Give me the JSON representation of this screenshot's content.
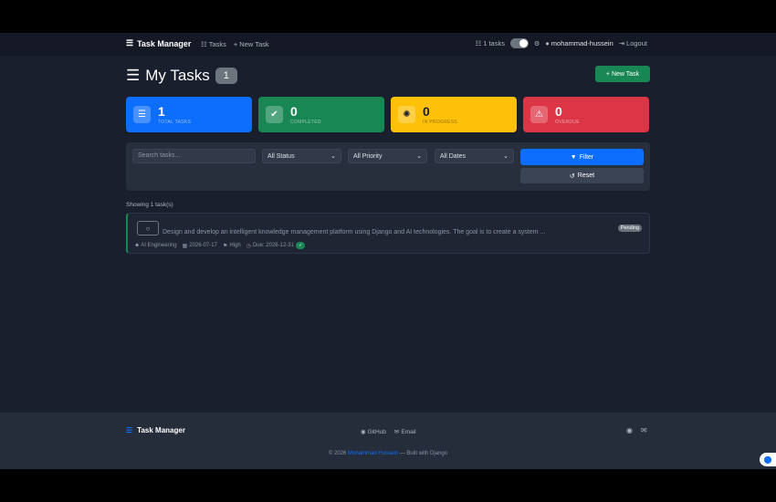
{
  "nav": {
    "brand": "Task Manager",
    "tasks_link": "Tasks",
    "new_task_link": "New Task",
    "task_count": "1 tasks",
    "username": "mohammad-hussein",
    "logout": "Logout"
  },
  "header": {
    "title": "My Tasks",
    "count": "1",
    "new_task_button": "New Task"
  },
  "stats": [
    {
      "value": "1",
      "label": "TOTAL TASKS",
      "color": "#0d6efd",
      "icon": "list-check-icon"
    },
    {
      "value": "0",
      "label": "COMPLETED",
      "color": "#198754",
      "icon": "check-circle-icon"
    },
    {
      "value": "0",
      "label": "IN PROGRESS",
      "color": "#ffc107",
      "icon": "spinner-icon"
    },
    {
      "value": "0",
      "label": "OVERDUE",
      "color": "#dc3545",
      "icon": "warning-icon"
    }
  ],
  "filter": {
    "search_placeholder": "Search tasks...",
    "status": "All Status",
    "priority": "All Priority",
    "dates": "All Dates",
    "filter_button": "Filter",
    "reset_button": "Reset"
  },
  "showing": "Showing 1 task(s)",
  "tasks": [
    {
      "description": "Design and develop an intelligent knowledge management platform using Django and AI technologies. The goal is to create a system ...",
      "status": "Pending",
      "category": "AI Engineering",
      "created": "2026-07-17",
      "priority": "High",
      "due": "Due: 2026-12-31",
      "due_badge": "✓"
    }
  ],
  "footer": {
    "brand": "Task Manager",
    "github": "GitHub",
    "email": "Email",
    "copyright_prefix": "© 2026",
    "author": "Mohammad Hussein",
    "copyright_suffix": "— Built with Django"
  }
}
